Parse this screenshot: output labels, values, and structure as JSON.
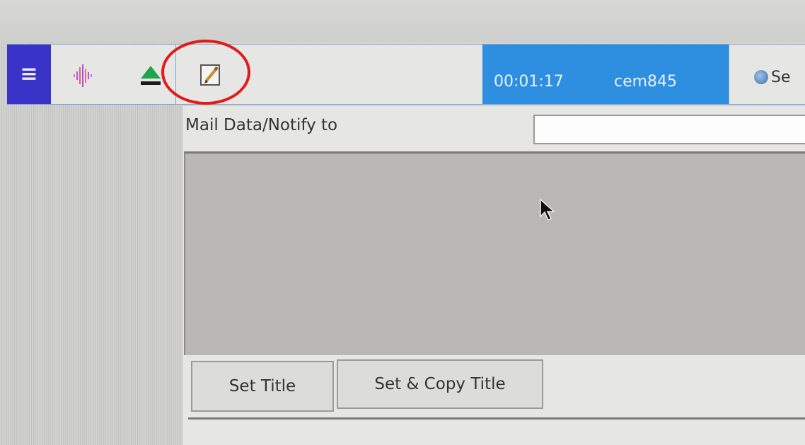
{
  "taskbar": {
    "menu_icon": "hamburger-icon",
    "launchers": [
      {
        "icon": "audio-wave-icon",
        "color": "#c24fd6"
      },
      {
        "icon": "eject-icon",
        "color": "#1fa64a"
      },
      {
        "icon": "edit-icon",
        "color": "#8a5a2b"
      }
    ],
    "status": {
      "timer": "00:01:17",
      "user": "cem845"
    },
    "clock_label": "Se"
  },
  "dialog": {
    "notify_label": "Mail Data/Notify to",
    "notify_value": "",
    "notify_placeholder": "",
    "buttons": {
      "set_title": "Set Title",
      "set_copy_title": "Set & Copy Title"
    }
  },
  "annotation": {
    "circle_color": "#e21a1a",
    "highlighted": "edit-icon"
  },
  "colors": {
    "menu_bg": "#3a33c8",
    "status_bg": "#2e8fe0",
    "accent_border": "#7ea6cf"
  }
}
